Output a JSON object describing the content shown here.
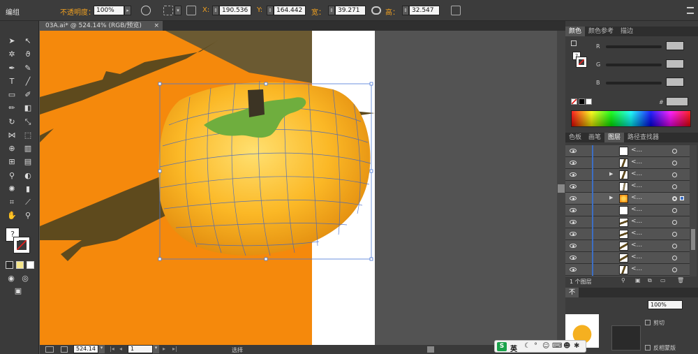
{
  "control_bar": {
    "group_label": "编组",
    "opacity_label": "不透明度：",
    "opacity_value": "100%",
    "x_label": "X:",
    "x_value": "190.536",
    "y_label": "Y:",
    "y_value": "164.442",
    "w_label": "宽：",
    "w_value": "39.271",
    "h_label": "高：",
    "h_value": "32.547"
  },
  "document": {
    "tab_title": "03A.ai* @ 524.14% (RGB/预览)",
    "close_glyph": "×"
  },
  "status_bar": {
    "zoom_value": "524.14",
    "page_value": "1",
    "tool_label": "选择"
  },
  "color_panel": {
    "tabs": [
      "颜色",
      "颜色参考",
      "描边"
    ],
    "channels": [
      "R",
      "G",
      "B"
    ],
    "hex_label": "#",
    "question_glyph": "?"
  },
  "layers_panel": {
    "tabs": [
      "色板",
      "画笔",
      "图层",
      "路径查找器"
    ],
    "active_tab": "图层",
    "row_label": "<...",
    "count_label": "1 个图层"
  },
  "bottom_panel": {
    "percent_value": "100%",
    "clip_label": "剪切",
    "invert_mask_label": "反相蒙版",
    "partial_tab": "不"
  },
  "taskbar": {
    "ime_label": "英"
  },
  "colors": {
    "accent_orange": "#f0a020",
    "canvas_orange": "#f5890c",
    "branch_brown": "#5e4a1d",
    "mesh_blue": "#3a62c8",
    "leaf_green": "#6fae3e"
  }
}
